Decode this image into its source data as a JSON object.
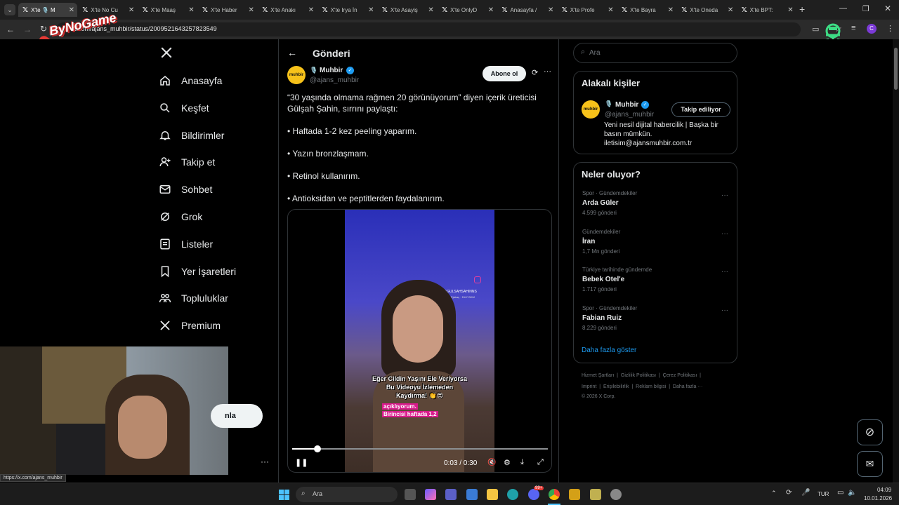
{
  "browser": {
    "tabs": [
      {
        "label": "X'te 🎙️ M"
      },
      {
        "label": "X'te No Cu"
      },
      {
        "label": "X'te Maaş"
      },
      {
        "label": "X'te Haber"
      },
      {
        "label": "X'te Anakı"
      },
      {
        "label": "X'te Irya İn"
      },
      {
        "label": "X'te Asayiş"
      },
      {
        "label": "X'te OnlyD"
      },
      {
        "label": "Anasayfa /"
      },
      {
        "label": "X'te Profe"
      },
      {
        "label": "X'te Bayra"
      },
      {
        "label": "X'te Oneda"
      },
      {
        "label": "X'te BPT:"
      }
    ],
    "url": "x.com/ajans_muhbir/status/2009521643257823549",
    "profile_initial": "C",
    "status_url": "https://x.com/ajans_muhbir"
  },
  "overlay": {
    "brand": "ByNoGame"
  },
  "nav": {
    "items": [
      {
        "label": "Anasayfa",
        "icon": "home-icon"
      },
      {
        "label": "Keşfet",
        "icon": "search-icon"
      },
      {
        "label": "Bildirimler",
        "icon": "bell-icon"
      },
      {
        "label": "Takip et",
        "icon": "person-add-icon"
      },
      {
        "label": "Sohbet",
        "icon": "mail-icon"
      },
      {
        "label": "Grok",
        "icon": "grok-icon"
      },
      {
        "label": "Listeler",
        "icon": "list-icon"
      },
      {
        "label": "Yer İşaretleri",
        "icon": "bookmark-icon"
      },
      {
        "label": "Topluluklar",
        "icon": "people-icon"
      },
      {
        "label": "Premium",
        "icon": "x-logo-icon"
      }
    ],
    "post_button_partial": "nla",
    "more": "···"
  },
  "post": {
    "header_title": "Gönderi",
    "author_name": "Muhbir",
    "author_handle": "@ajans_muhbir",
    "avatar_text": "muhbir",
    "subscribe_label": "Abone ol",
    "lines": [
      "“30 yaşında olmama rağmen 20 görünüyorum” diyen içerik üreticisi",
      "Gülşah Şahin, sırrını paylaştı:",
      "• Haftada 1-2 kez peeling yaparım.",
      "• Yazın bronzlaşmam.",
      "• Retinol kullanırım.",
      "• Antioksidan ve peptitlerden faydalanırım."
    ],
    "video": {
      "time": "0:03 / 0:30",
      "progress": 0.1,
      "watermark_handle": "@GULSAHSAHINNS",
      "watermark_sub": "Güleeal Ejabaç · DUY BKM",
      "caption_1": "Eğer Cildin Yaşını Ele Veriyorsa",
      "caption_2": "Bu Videoyu İzlemeden",
      "caption_3": "Kaydırma! 👏😍",
      "sub_1": "açıklıyorum.",
      "sub_2": "Birincisi haftada 1,2"
    }
  },
  "sidebar": {
    "search_placeholder": "Ara",
    "related_title": "Alakalı kişiler",
    "person": {
      "name": "Muhbir",
      "handle": "@ajans_muhbir",
      "follow_label": "Takip ediliyor",
      "bio_1": "Yeni nesil dijital habercilik | Başka bir",
      "bio_2": "basın mümkün.",
      "bio_3": "iletisim@ajansmuhbir.com.tr"
    },
    "trends_title": "Neler oluyor?",
    "trends": [
      {
        "context": "Spor · Gündemdekiler",
        "topic": "Arda Güler",
        "count": "4.599 gönderi"
      },
      {
        "context": "Gündemdekiler",
        "topic": "İran",
        "count": "1,7 Mn gönderi"
      },
      {
        "context": "Türkiye tarihinde gündemde",
        "topic": "Bebek Otel'e",
        "count": "1.717 gönderi"
      },
      {
        "context": "Spor · Gündemdekiler",
        "topic": "Fabian Ruiz",
        "count": "8.229 gönderi"
      }
    ],
    "show_more": "Daha fazla göster",
    "footer_1": "Hizmet Şartları  |  Gizlilik Politikası  |  Çerez Politikası  |",
    "footer_2": "Imprint  |  Erişilebilirlik  |  Reklam bilgisi  |  Daha fazla ···",
    "footer_3": "© 2026 X Corp."
  },
  "taskbar": {
    "search_label": "Ara",
    "lang": "TUR",
    "time": "04:09",
    "date": "10.01.2026",
    "badge": "99+"
  },
  "colors": {
    "accent": "#1d9bf0",
    "bg": "#000000",
    "border": "#2f3336",
    "avatar_bg": "#f7c21a"
  }
}
